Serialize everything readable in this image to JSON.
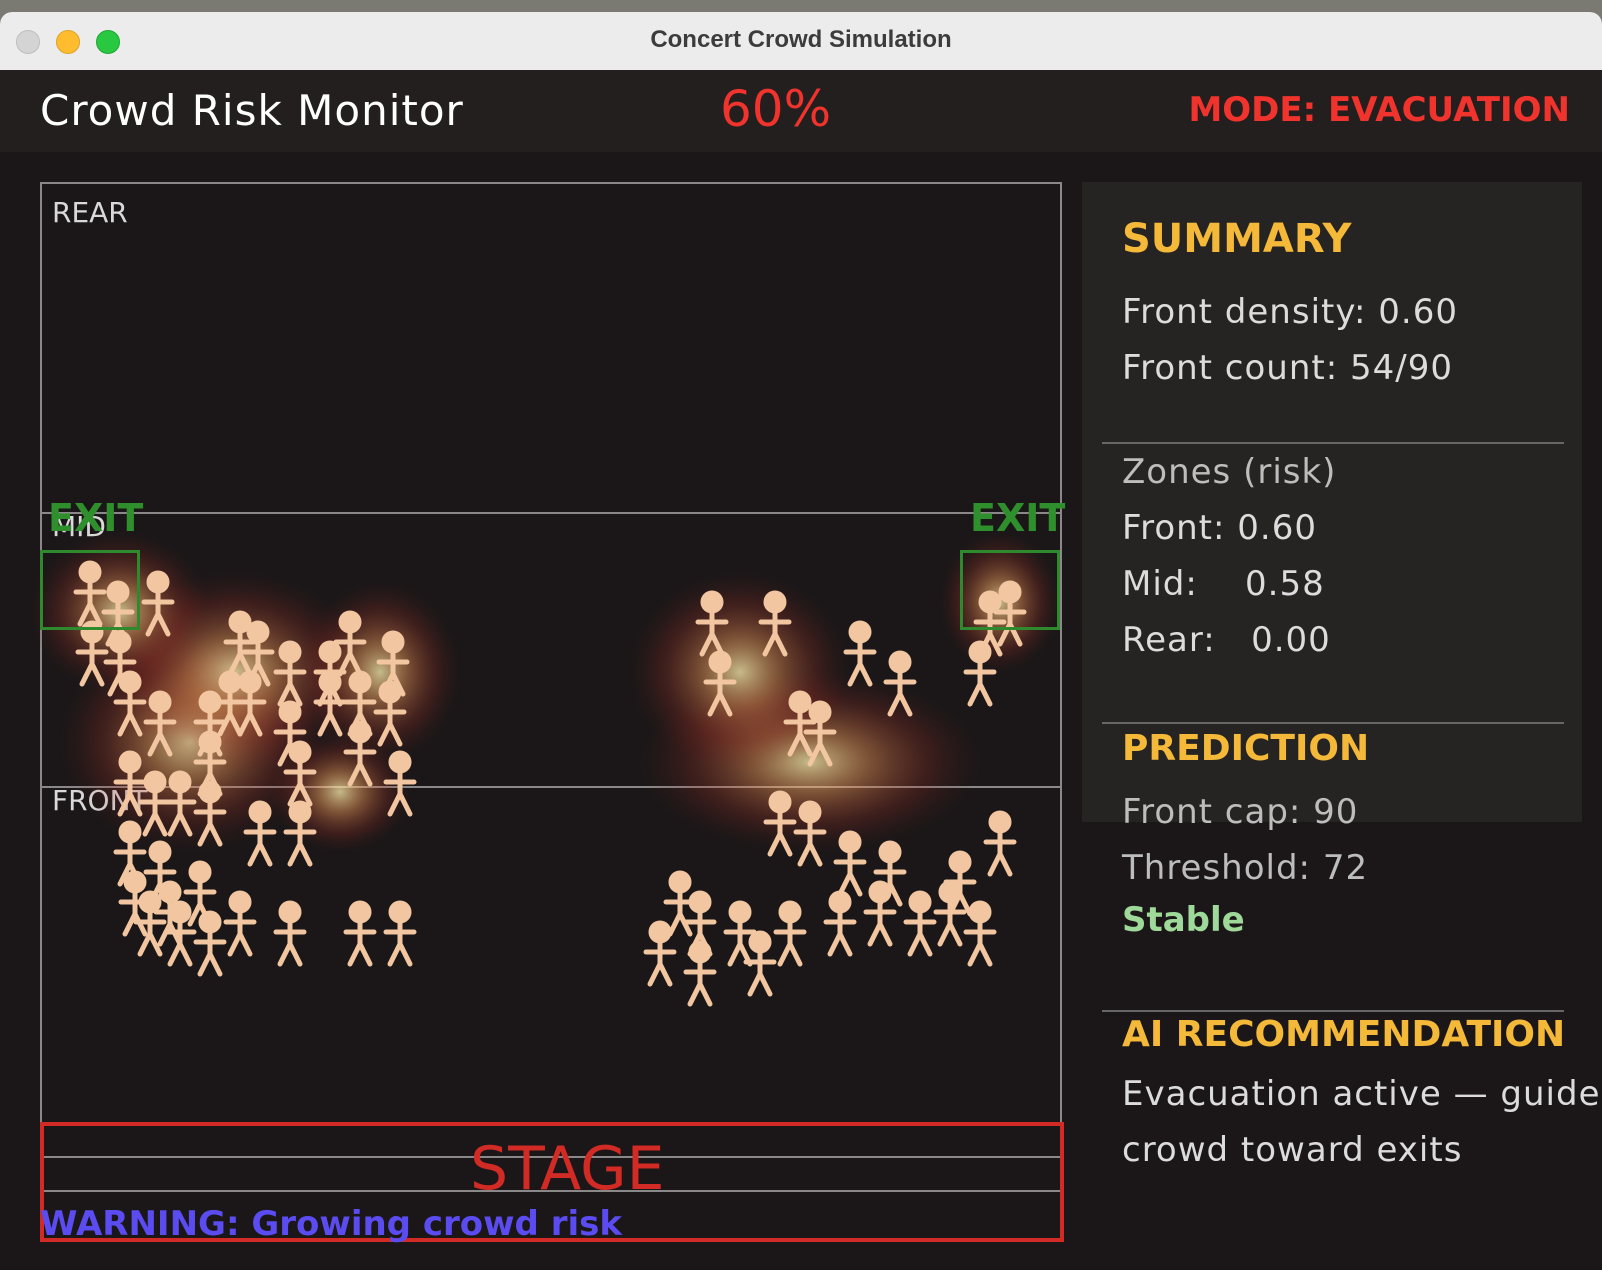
{
  "window": {
    "title": "Concert Crowd Simulation",
    "controls": [
      "close",
      "minimize",
      "maximize"
    ]
  },
  "header": {
    "app_title": "Crowd Risk Monitor",
    "risk_percent": "60%",
    "mode": "MODE: EVACUATION"
  },
  "venue": {
    "zones": {
      "rear": "REAR",
      "mid": "MID",
      "front": "FRONT"
    },
    "exits": {
      "left": "EXIT",
      "right": "EXIT"
    },
    "stage": "STAGE",
    "warning": "WARNING: Growing crowd risk"
  },
  "panel": {
    "summary": {
      "heading": "SUMMARY",
      "front_density": "Front density: 0.60",
      "front_count": "Front count: 54/90"
    },
    "zones": {
      "heading": "Zones (risk)",
      "front": "Front: 0.60",
      "mid": "Mid:    0.58",
      "rear": "Rear:   0.00"
    },
    "prediction": {
      "heading": "PREDICTION",
      "front_cap": "Front cap: 90",
      "threshold": "Threshold: 72",
      "status": "Stable"
    },
    "recommendation": {
      "heading": "AI RECOMMENDATION",
      "line1": "Evacuation active — guide",
      "line2": "crowd toward exits"
    }
  },
  "colors": {
    "danger": "#f0332c",
    "heading": "#f5b93a",
    "exit": "#2e8a2c",
    "warning": "#5a4cf0",
    "stable": "#9fd99a",
    "person": "#f2c6a0"
  }
}
